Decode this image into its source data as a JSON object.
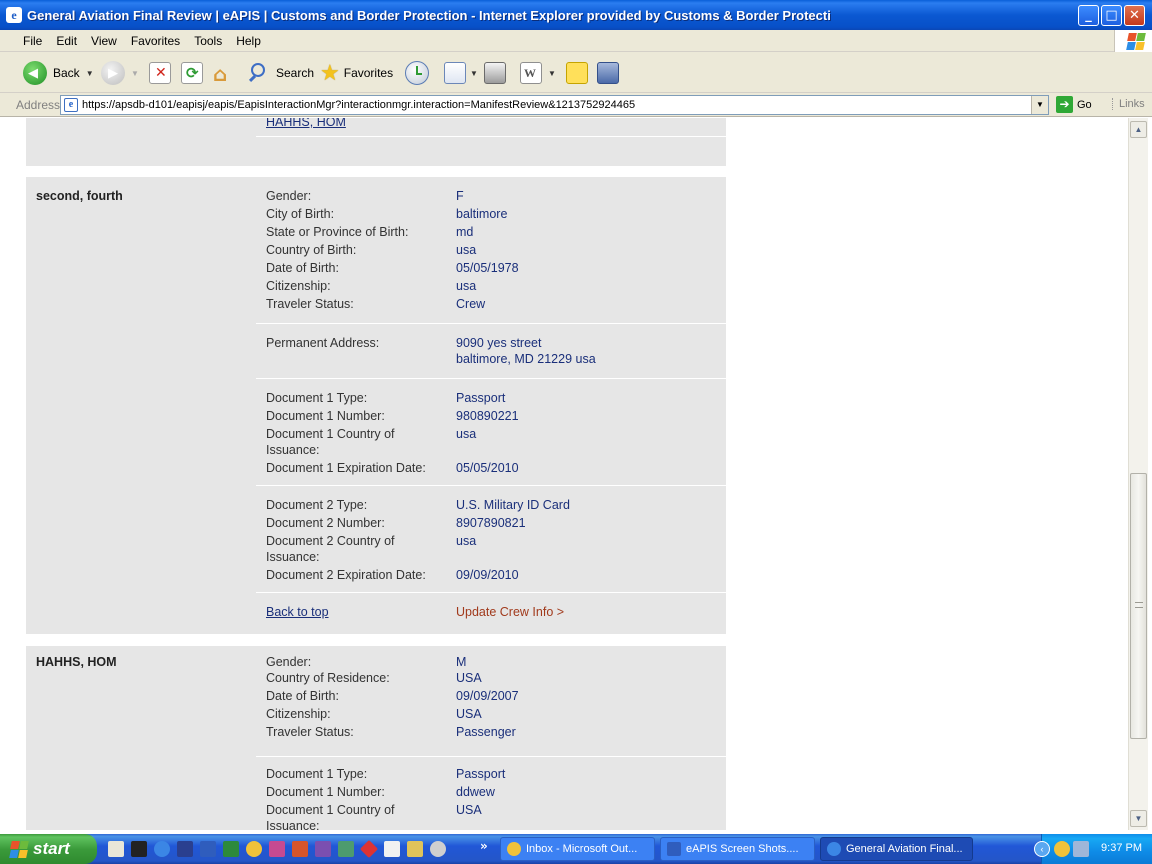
{
  "window": {
    "title": "General Aviation Final Review | eAPIS | Customs and Border Protection - Internet Explorer provided by Customs & Border Protecti",
    "min": "_",
    "max": "□",
    "close": "✕"
  },
  "menu": [
    "File",
    "Edit",
    "View",
    "Favorites",
    "Tools",
    "Help"
  ],
  "toolbar": {
    "back": "Back",
    "search": "Search",
    "favorites": "Favorites"
  },
  "address": {
    "label": "Address",
    "url": "https://apsdb-d101/eapisj/eapis/EapisInteractionMgr?interactionmgr.interaction=ManifestReview&1213752924465",
    "go": "Go",
    "links": "Links"
  },
  "page": {
    "top_partial_link": "HAHHS, HOM",
    "travelers": [
      {
        "name": "second, fourth",
        "details": [
          {
            "label": "Gender:",
            "value": "F"
          },
          {
            "label": "City of Birth:",
            "value": "baltimore"
          },
          {
            "label": "State or Province of Birth:",
            "value": "md"
          },
          {
            "label": "Country of Birth:",
            "value": "usa"
          },
          {
            "label": "Date of Birth:",
            "value": "05/05/1978"
          },
          {
            "label": "Citizenship:",
            "value": "usa"
          },
          {
            "label": "Traveler Status:",
            "value": "Crew"
          }
        ],
        "address": {
          "label": "Permanent Address:",
          "line1": "9090 yes street",
          "line2": "baltimore, MD 21229 usa"
        },
        "doc1": {
          "type_label": "Document 1 Type:",
          "type": "Passport",
          "number_label": "Document 1 Number:",
          "number": "980890221",
          "country_label_1": "Document 1 Country of",
          "country_label_2": "Issuance:",
          "country": "usa",
          "exp_label": "Document 1 Expiration Date:",
          "exp": "05/05/2010"
        },
        "doc2": {
          "type_label": "Document 2 Type:",
          "type": "U.S. Military ID Card",
          "number_label": "Document 2 Number:",
          "number": "8907890821",
          "country_label_1": "Document 2 Country of",
          "country_label_2": "Issuance:",
          "country": "usa",
          "exp_label": "Document 2 Expiration Date:",
          "exp": "09/09/2010"
        },
        "back_to_top": "Back to top",
        "update": "Update Crew Info >"
      },
      {
        "name": "HAHHS, HOM",
        "details": [
          {
            "label": "Gender:",
            "value": "M"
          },
          {
            "label": "Country of Residence:",
            "value": "USA"
          },
          {
            "label": "Date of Birth:",
            "value": "09/09/2007"
          },
          {
            "label": "Citizenship:",
            "value": "USA"
          },
          {
            "label": "Traveler Status:",
            "value": "Passenger"
          }
        ],
        "doc1": {
          "type_label": "Document 1 Type:",
          "type": "Passport",
          "number_label": "Document 1 Number:",
          "number": "ddwew",
          "country_label_1": "Document 1 Country of",
          "country_label_2": "Issuance:",
          "country": "USA"
        }
      }
    ]
  },
  "taskbar": {
    "start": "start",
    "tasks": [
      "Inbox - Microsoft Out...",
      "eAPIS Screen Shots....",
      "General Aviation Final..."
    ],
    "clock": "9:37 PM"
  },
  "colors": {
    "panel": "#e6e6e6",
    "value_text": "#1a2f7a",
    "update_link": "#a13a1c",
    "titlebar": "#0b58d2"
  }
}
